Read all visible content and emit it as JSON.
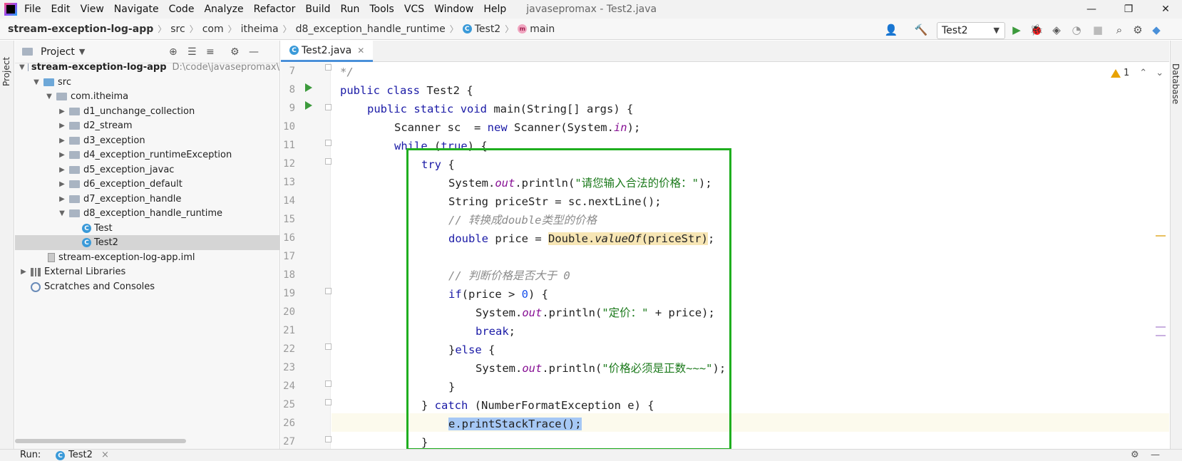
{
  "menubar": {
    "items": [
      "File",
      "Edit",
      "View",
      "Navigate",
      "Code",
      "Analyze",
      "Refactor",
      "Build",
      "Run",
      "Tools",
      "VCS",
      "Window",
      "Help"
    ],
    "window_title": "javasepromax - Test2.java",
    "minimize": "—",
    "maximize": "❐",
    "close": "✕"
  },
  "navbar": {
    "breadcrumbs": [
      "stream-exception-log-app",
      "src",
      "com",
      "itheima",
      "d8_exception_handle_runtime",
      "Test2",
      "main"
    ],
    "run_config": "Test2"
  },
  "left_stripe": {
    "label": "Project"
  },
  "project_panel": {
    "title": "Project",
    "tree": [
      {
        "label": "stream-exception-log-app",
        "hint": "D:\\code\\javasepromax\\",
        "level": 0,
        "expanded": true,
        "icon": "module-folder-icon"
      },
      {
        "label": "src",
        "level": 1,
        "expanded": true,
        "icon": "source-folder-icon"
      },
      {
        "label": "com.itheima",
        "level": 2,
        "expanded": true,
        "icon": "package-icon"
      },
      {
        "label": "d1_unchange_collection",
        "level": 3,
        "expanded": false,
        "icon": "package-icon"
      },
      {
        "label": "d2_stream",
        "level": 3,
        "expanded": false,
        "icon": "package-icon"
      },
      {
        "label": "d3_exception",
        "level": 3,
        "expanded": false,
        "icon": "package-icon"
      },
      {
        "label": "d4_exception_runtimeException",
        "level": 3,
        "expanded": false,
        "icon": "package-icon"
      },
      {
        "label": "d5_exception_javac",
        "level": 3,
        "expanded": false,
        "icon": "package-icon"
      },
      {
        "label": "d6_exception_default",
        "level": 3,
        "expanded": false,
        "icon": "package-icon"
      },
      {
        "label": "d7_exception_handle",
        "level": 3,
        "expanded": false,
        "icon": "package-icon"
      },
      {
        "label": "d8_exception_handle_runtime",
        "level": 3,
        "expanded": true,
        "icon": "package-icon"
      },
      {
        "label": "Test",
        "level": 4,
        "icon": "java-class-icon"
      },
      {
        "label": "Test2",
        "level": 4,
        "icon": "java-class-icon",
        "selected": true
      },
      {
        "label": "stream-exception-log-app.iml",
        "level": 2,
        "icon": "iml-file-icon"
      },
      {
        "label": "External Libraries",
        "level": 0,
        "expanded": false,
        "icon": "library-icon"
      },
      {
        "label": "Scratches and Consoles",
        "level": 0,
        "icon": "scratches-icon"
      }
    ]
  },
  "editor": {
    "tab_label": "Test2.java",
    "warning_count": "1",
    "line_numbers": [
      "7",
      "8",
      "9",
      "10",
      "11",
      "12",
      "13",
      "14",
      "15",
      "16",
      "17",
      "18",
      "19",
      "20",
      "21",
      "22",
      "23",
      "24",
      "25",
      "26",
      "27"
    ],
    "lines": {
      "l7": "*/",
      "l8_kw1": "public",
      "l8_kw2": "class",
      "l8_rest": " Test2 {",
      "l9_kw1": "public",
      "l9_kw2": "static",
      "l9_kw3": "void",
      "l9_rest": " main(String[] args) {",
      "l10_a": "Scanner sc  = ",
      "l10_kw": "new",
      "l10_b": " Scanner(System.",
      "l10_fld": "in",
      "l10_c": ");",
      "l11_kw1": "while",
      "l11_a": " (",
      "l11_kw2": "true",
      "l11_b": ") {",
      "l12_kw": "try",
      "l12_rest": " {",
      "l13_a": "System.",
      "l13_fld": "out",
      "l13_b": ".println(",
      "l13_str": "\"请您输入合法的价格：\"",
      "l13_c": ");",
      "l14": "String priceStr = sc.nextLine();",
      "l15": "// 转换成double类型的价格",
      "l16_kw": "double",
      "l16_a": " price = ",
      "l16_hl_a": "Double.",
      "l16_hl_b": "valueOf",
      "l16_hl_c": "(priceStr)",
      "l16_b": ";",
      "l18": "// 判断价格是否大于 0",
      "l19_kw": "if",
      "l19_a": "(price > ",
      "l19_num": "0",
      "l19_b": ") {",
      "l20_a": "System.",
      "l20_fld": "out",
      "l20_b": ".println(",
      "l20_str": "\"定价：\"",
      "l20_c": " + price);",
      "l21_kw": "break",
      "l21_rest": ";",
      "l22_a": "}",
      "l22_kw": "else",
      "l22_b": " {",
      "l23_a": "System.",
      "l23_fld": "out",
      "l23_b": ".println(",
      "l23_str": "\"价格必须是正数~~~\"",
      "l23_c": ");",
      "l24": "}",
      "l25_a": "} ",
      "l25_kw": "catch",
      "l25_b": " (NumberFormatException e) {",
      "l26_sel": "e.printStackTrace();",
      "l27": "}"
    }
  },
  "right_stripe": {
    "label": "Database"
  },
  "bottom_bar": {
    "run_label": "Run:",
    "tab_label": "Test2",
    "close": "×"
  },
  "colors": {
    "accent_green_box": "#1fae1f",
    "selection": "#a6c8f5",
    "current_line": "#fcfaed"
  }
}
